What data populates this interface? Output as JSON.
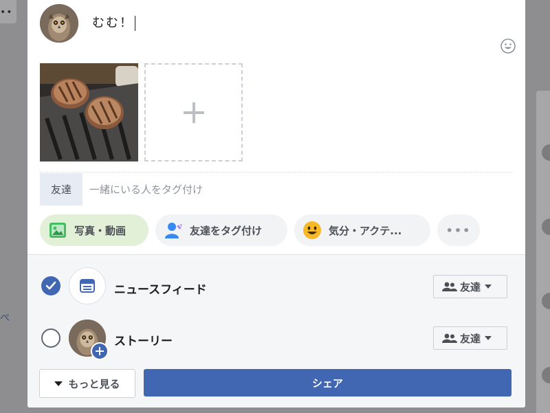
{
  "composer": {
    "post_text": "むむ！",
    "tag": {
      "label": "友達",
      "placeholder": "一緒にいる人をタグ付け"
    },
    "actions": {
      "photo": "写真・動画",
      "tag_friends": "友達をタグ付け",
      "feeling": "気分・アクテ...",
      "more": "•••"
    }
  },
  "share": {
    "news_feed": {
      "label": "ニュースフィード",
      "audience": "友達",
      "selected": true
    },
    "story": {
      "label": "ストーリー",
      "audience": "友達",
      "selected": false
    },
    "more_button": "もっと見る",
    "share_button": "シェア"
  },
  "colors": {
    "accent": "#4267b2",
    "photo_pill_bg": "#e3f0d8"
  },
  "icons": [
    "emoji-icon",
    "add-photo-plus-icon",
    "photo-video-icon",
    "tag-friends-icon",
    "feeling-emoji-icon",
    "more-dots-icon",
    "checkmark-icon",
    "news-feed-icon",
    "story-add-icon",
    "friends-icon",
    "dropdown-caret-icon"
  ]
}
